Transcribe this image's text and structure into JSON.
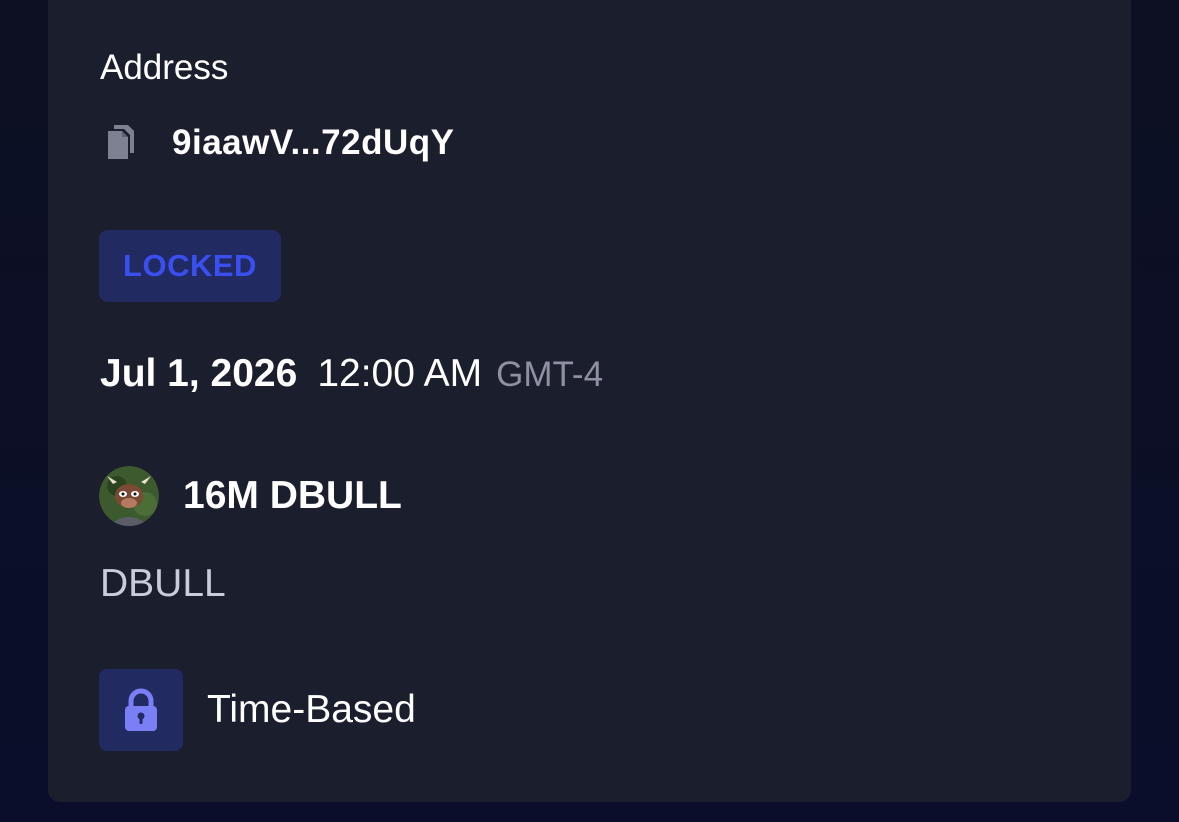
{
  "address": {
    "label": "Address",
    "value": "9iaawV...72dUqY",
    "copy_icon": "copy-icon"
  },
  "status": {
    "badge": "LOCKED",
    "color": "#3a4ff0"
  },
  "unlock": {
    "date": "Jul 1, 2026",
    "time": "12:00 AM",
    "timezone": "GMT-4"
  },
  "token": {
    "amount": "16M DBULL",
    "symbol": "DBULL",
    "avatar_icon": "bull-avatar"
  },
  "lock_type": {
    "icon": "lock-icon",
    "label": "Time-Based"
  },
  "colors": {
    "card_bg": "#1b1e2d",
    "accent_bg": "#222a62",
    "lock_icon": "#7b7ff5"
  }
}
